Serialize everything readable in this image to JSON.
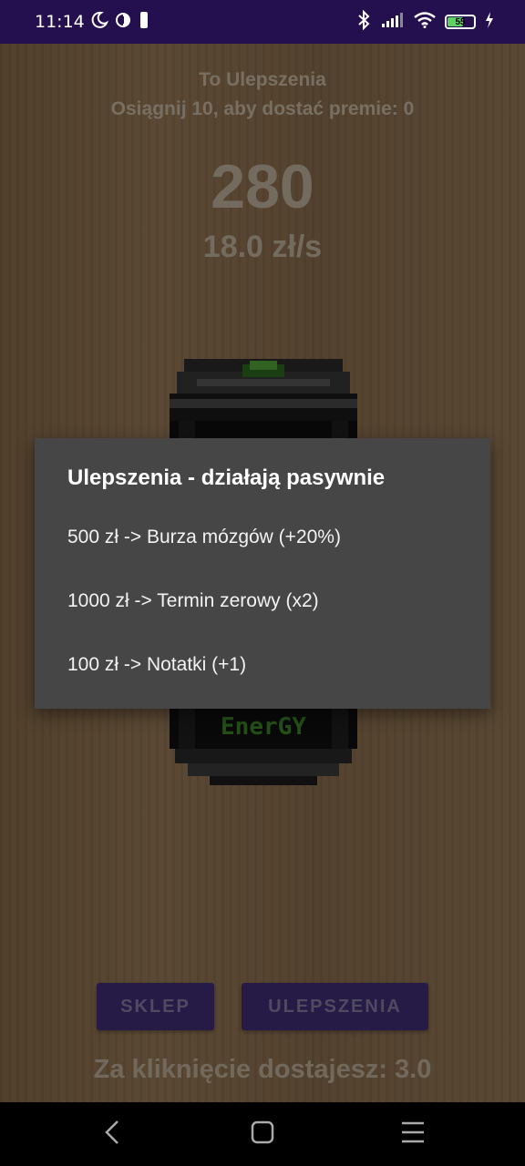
{
  "status_bar": {
    "time": "11:14",
    "battery": "55",
    "icons": [
      "moon-icon",
      "data-saver-icon",
      "sim-icon",
      "bluetooth-icon",
      "signal-icon",
      "wifi-icon",
      "battery-icon",
      "charging-icon"
    ]
  },
  "header": {
    "title": "To Ulepszenia",
    "subtitle": "Osiągnij 10, aby dostać premie: 0"
  },
  "counter": {
    "score": "280",
    "rate": "18.0 zł/s"
  },
  "can_label": "EnerGY",
  "buttons": {
    "shop": "SKLEP",
    "upgrades": "ULEPSZENIA"
  },
  "footer": {
    "per_click": "Za kliknięcie dostajesz: 3.0"
  },
  "dialog": {
    "title": "Ulepszenia - działają pasywnie",
    "items": [
      "500 zł -> Burza mózgów (+20%)",
      "1000 zł -> Termin zerowy (x2)",
      "100 zł -> Notatki (+1)"
    ]
  },
  "colors": {
    "status_bar": "#24104f",
    "button": "#43307a",
    "dialog_bg": "#464646",
    "background": "#8b6c4a"
  }
}
